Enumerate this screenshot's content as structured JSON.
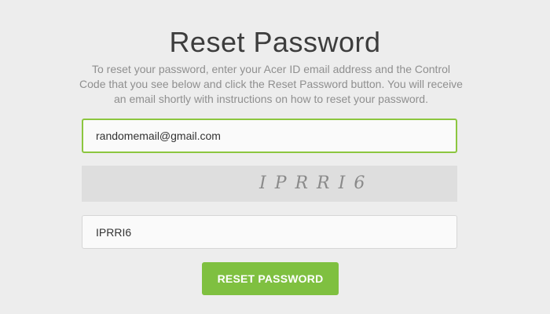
{
  "page": {
    "title": "Reset Password",
    "description": "To reset your password, enter your Acer ID email address and the Control Code that you see below and click the Reset Password button. You will receive an email shortly with instructions on how to reset your password."
  },
  "form": {
    "email_value": "randomemail@gmail.com",
    "captcha_text": "IPRRI6",
    "control_code_value": "IPRRI6",
    "submit_label": "RESET PASSWORD"
  },
  "colors": {
    "accent_green": "#7fc040",
    "focus_border": "#8cc63f",
    "background": "#ededed"
  }
}
